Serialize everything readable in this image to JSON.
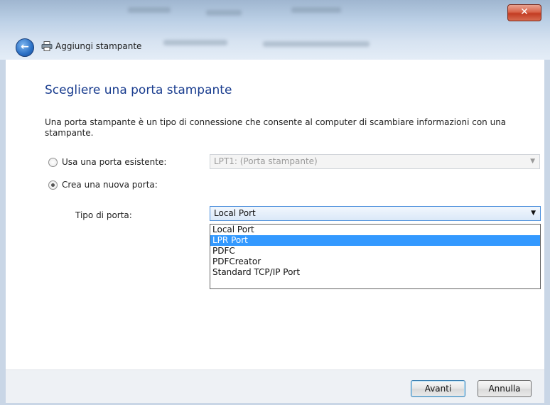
{
  "window": {
    "title": "Aggiungi stampante",
    "close_glyph": "✕",
    "back_glyph": "←"
  },
  "page": {
    "heading": "Scegliere una porta stampante",
    "description": "Una porta stampante è un tipo di connessione che consente al computer di scambiare informazioni con una stampante."
  },
  "existing_port": {
    "label": "Usa una porta esistente:",
    "selected": false,
    "value": "LPT1: (Porta stampante)"
  },
  "new_port": {
    "label": "Crea una nuova porta:",
    "selected": true,
    "type_label": "Tipo di porta:",
    "value": "Local Port",
    "options": [
      "Local Port",
      "LPR Port",
      "PDFC",
      "PDFCreator",
      "Standard TCP/IP Port"
    ],
    "highlighted_option": "LPR Port"
  },
  "buttons": {
    "next": "Avanti",
    "cancel": "Annulla"
  },
  "icons": {
    "back": "back-arrow-icon",
    "printer": "printer-icon",
    "close": "close-icon",
    "dropdown": "chevron-down-icon"
  },
  "colors": {
    "heading": "#1a3d8f",
    "selection": "#3399ff",
    "close_button": "#c23b22"
  }
}
